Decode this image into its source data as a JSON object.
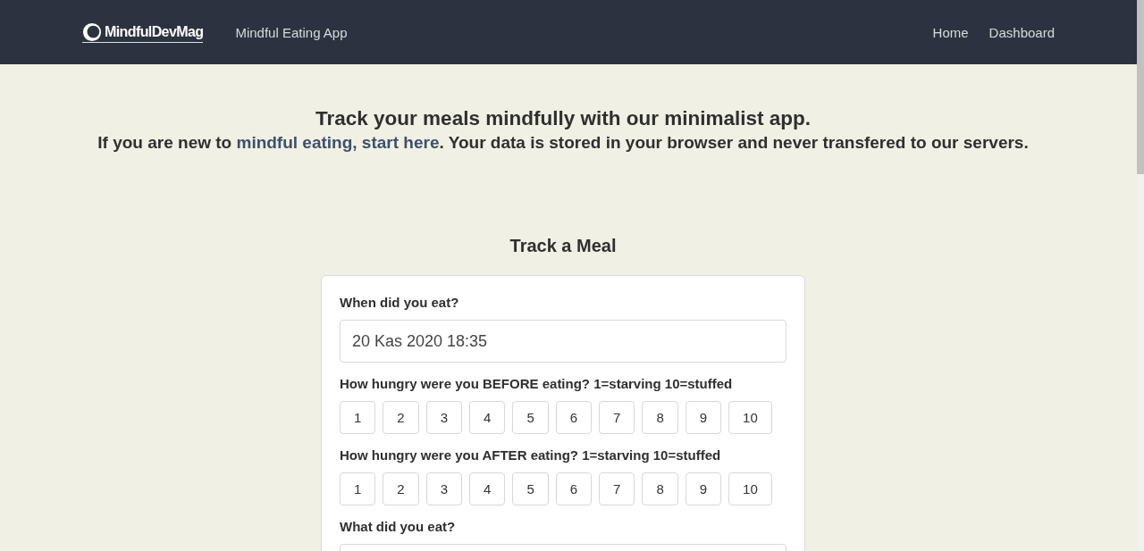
{
  "navbar": {
    "logo": "MindfulDevMag",
    "app_title": "Mindful Eating App",
    "links": [
      {
        "label": "Home"
      },
      {
        "label": "Dashboard"
      }
    ]
  },
  "intro": {
    "heading": "Track your meals mindfully with our minimalist app.",
    "text_before": "If you are new to ",
    "link": "mindful eating, start here",
    "text_after": ". Your data is stored in your browser and never transfered to our servers."
  },
  "form": {
    "title": "Track a Meal",
    "fields": [
      {
        "kind": "datetime",
        "label": "When did you eat?",
        "value": "20 Kas 2020 18:35"
      },
      {
        "kind": "scale",
        "label": "How hungry were you BEFORE eating? 1=starving 10=stuffed",
        "options": [
          {
            "label": "1",
            "selected": false
          },
          {
            "label": "2",
            "selected": false
          },
          {
            "label": "3",
            "selected": false
          },
          {
            "label": "4",
            "selected": false
          },
          {
            "label": "5",
            "selected": false
          },
          {
            "label": "6",
            "selected": false
          },
          {
            "label": "7",
            "selected": false
          },
          {
            "label": "8",
            "selected": false
          },
          {
            "label": "9",
            "selected": false
          },
          {
            "label": "10",
            "selected": false
          }
        ]
      },
      {
        "kind": "scale",
        "label": "How hungry were you AFTER eating? 1=starving 10=stuffed",
        "options": [
          {
            "label": "1",
            "selected": false
          },
          {
            "label": "2",
            "selected": false
          },
          {
            "label": "3",
            "selected": false
          },
          {
            "label": "4",
            "selected": false
          },
          {
            "label": "5",
            "selected": false
          },
          {
            "label": "6",
            "selected": false
          },
          {
            "label": "7",
            "selected": false
          },
          {
            "label": "8",
            "selected": false
          },
          {
            "label": "9",
            "selected": false
          },
          {
            "label": "10",
            "selected": false
          }
        ]
      },
      {
        "kind": "text",
        "label": "What did you eat?"
      }
    ]
  }
}
